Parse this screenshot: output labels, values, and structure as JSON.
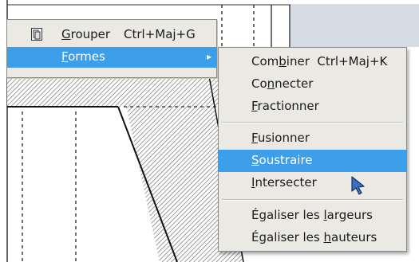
{
  "parent_menu": {
    "items": [
      {
        "label": "Grouper",
        "shortcut": "Ctrl+Maj+G",
        "icon": "group-icon"
      },
      {
        "label": "Formes",
        "has_submenu": true,
        "highlighted": true
      }
    ]
  },
  "submenu": {
    "items": [
      {
        "label": "Combiner",
        "shortcut": "Ctrl+Maj+K"
      },
      {
        "label": "Connecter"
      },
      {
        "label": "Fractionner"
      },
      {
        "label": "Fusionner"
      },
      {
        "label": "Soustraire",
        "highlighted": true
      },
      {
        "label": "Intersecter"
      },
      {
        "label": "Égaliser les largeurs"
      },
      {
        "label": "Égaliser les hauteurs"
      }
    ]
  },
  "colors": {
    "menu_bg": "#ebe9e3",
    "highlight": "#3d9ee9",
    "toolbar_bg": "#d6dce4"
  }
}
